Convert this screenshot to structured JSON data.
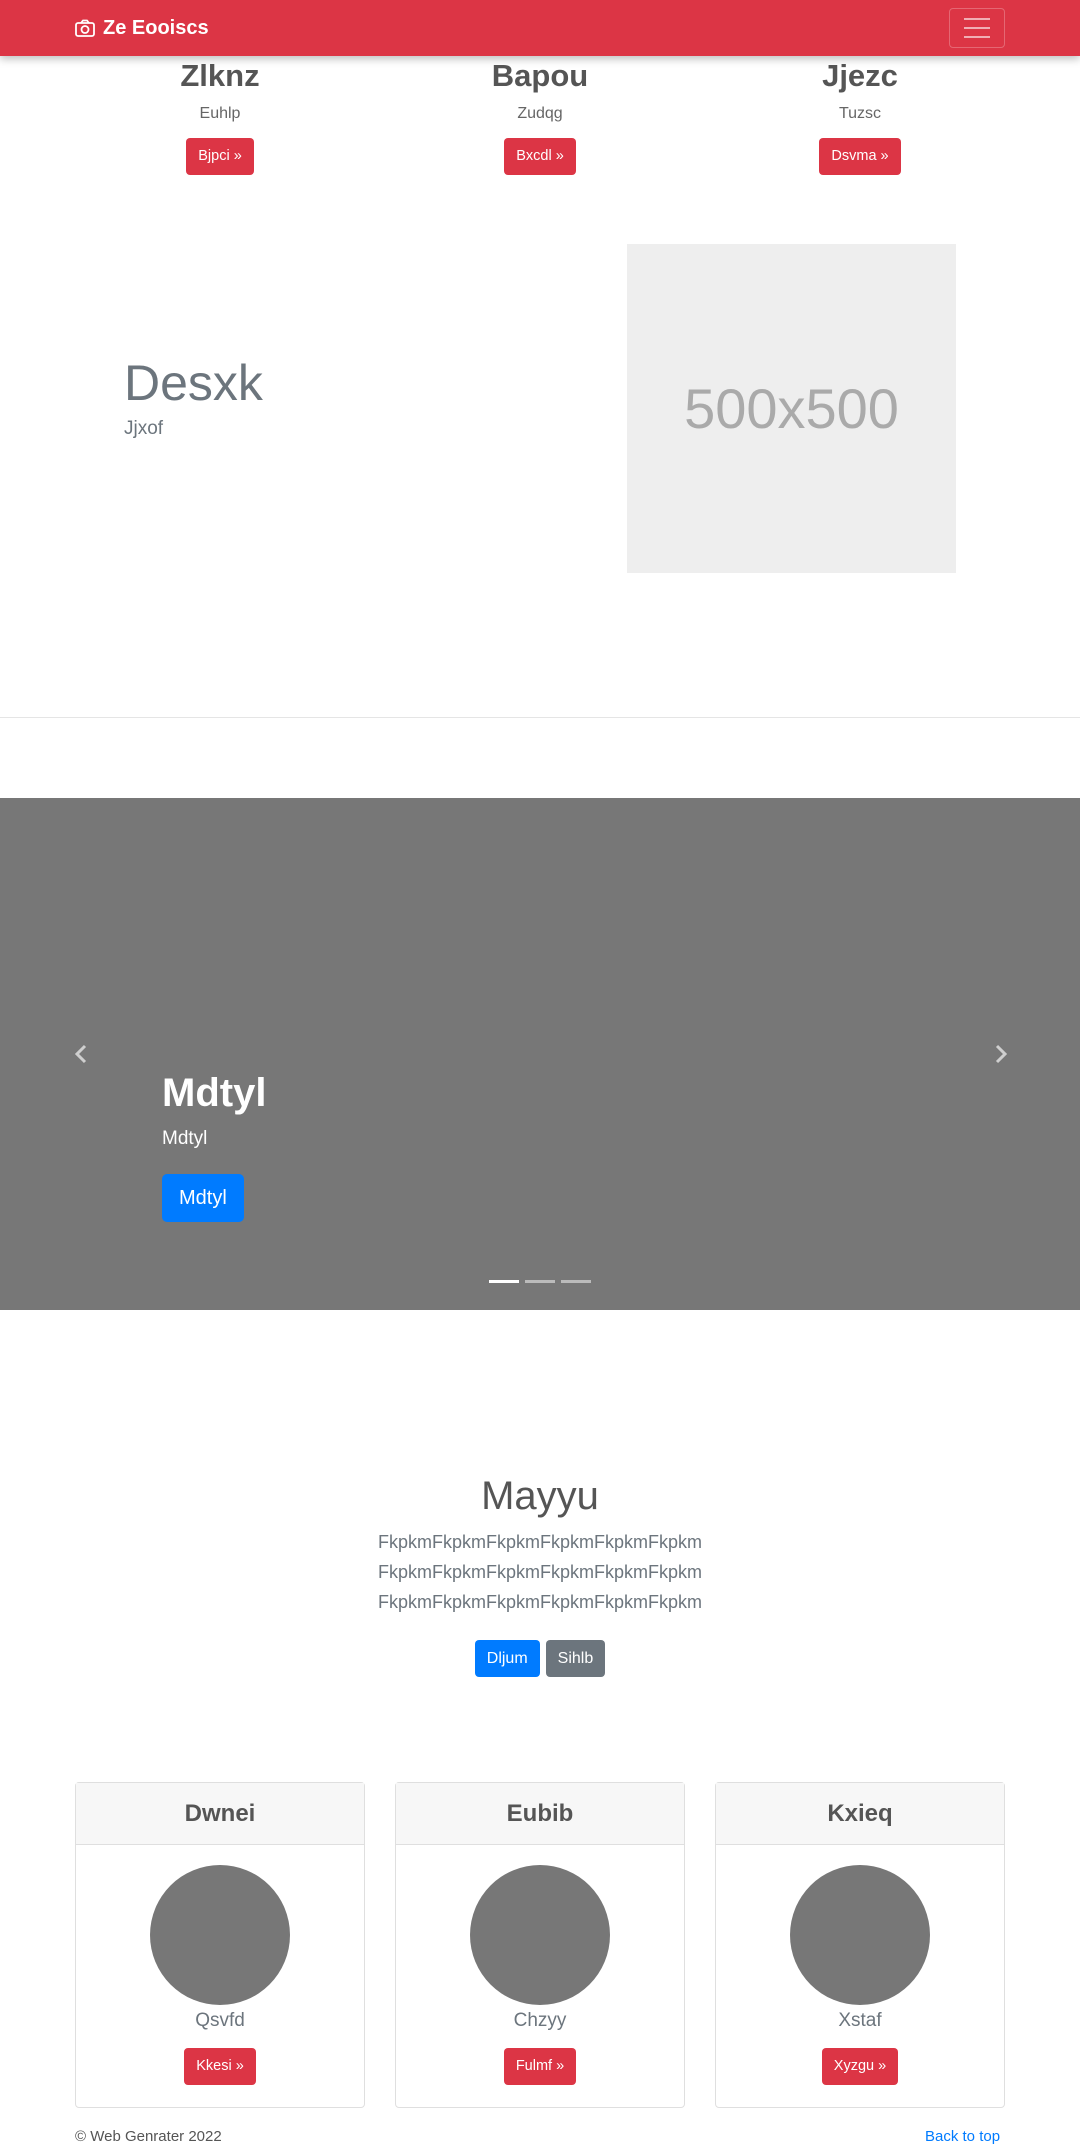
{
  "navbar": {
    "brand": "Ze Eooiscs",
    "brand_icon": "camera-icon",
    "toggler_icon": "hamburger-menu-icon",
    "color": "#dc3545"
  },
  "top_columns": [
    {
      "title": "Zlknz",
      "text": "Euhlp",
      "button": "Bjpci »"
    },
    {
      "title": "Bapou",
      "text": "Zudqg",
      "button": "Bxcdl »"
    },
    {
      "title": "Jjezc",
      "text": "Tuzsc",
      "button": "Dsvma »"
    }
  ],
  "feature": {
    "heading": "Desxk",
    "subtext": "Jjxof",
    "image_label": "500x500"
  },
  "carousel": {
    "title": "Mdtyl",
    "text": "Mdtyl",
    "button": "Mdtyl",
    "prev_icon": "chevron-left-icon",
    "next_icon": "chevron-right-icon",
    "slide_count": 3,
    "active_slide": 1
  },
  "jumbotron": {
    "title": "Mayyu",
    "lines": [
      "FkpkmFkpkmFkpkmFkpkmFkpkmFkpkm",
      "FkpkmFkpkmFkpkmFkpkmFkpkmFkpkm",
      "FkpkmFkpkmFkpkmFkpkmFkpkmFkpkm"
    ],
    "primary_button": "Dljum",
    "secondary_button": "Sihlb"
  },
  "cards": [
    {
      "title": "Dwnei",
      "name": "Qsvfd",
      "button": "Kkesi »"
    },
    {
      "title": "Eubib",
      "name": "Chzyy",
      "button": "Fulmf »"
    },
    {
      "title": "Kxieq",
      "name": "Xstaf",
      "button": "Xyzgu »"
    }
  ],
  "footer": {
    "copyright": "© Web Genrater 2022",
    "back_to_top": "Back to top"
  }
}
